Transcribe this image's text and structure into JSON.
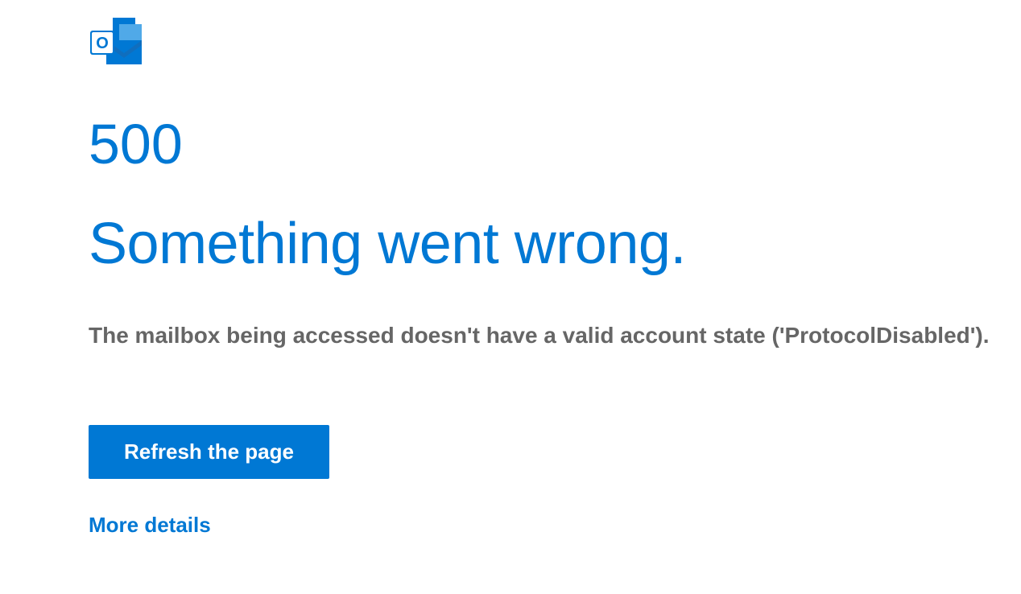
{
  "error": {
    "code": "500",
    "title": "Something went wrong.",
    "message": "The mailbox being accessed doesn't have a valid account state ('ProtocolDisabled')."
  },
  "actions": {
    "refresh_label": "Refresh the page",
    "more_details_label": "More details"
  }
}
